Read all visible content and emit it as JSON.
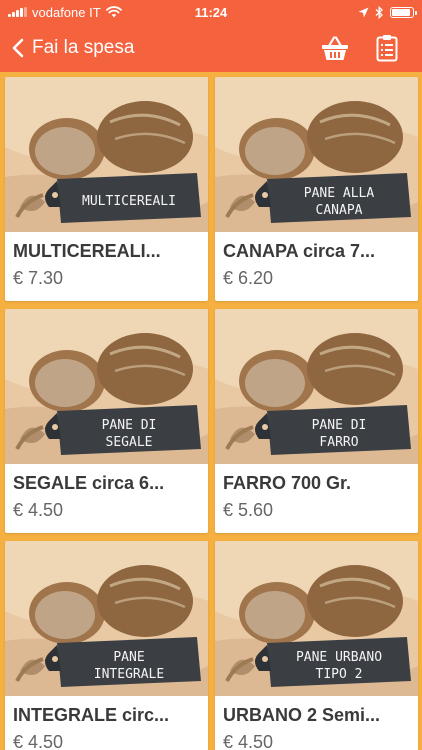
{
  "status_bar": {
    "carrier": "vodafone IT",
    "time": "11:24"
  },
  "nav": {
    "back_label": "Fai la spesa",
    "icons": [
      "chevron-left-icon",
      "basket-icon",
      "clipboard-list-icon"
    ]
  },
  "colors": {
    "header": "#F4623E",
    "background": "#F5B041",
    "card": "#FFFFFF",
    "chalkboard": "#3B3F44"
  },
  "products": [
    {
      "name": "MULTICEREALI...",
      "price": "€ 7.30",
      "label": [
        "MULTICEREALI"
      ]
    },
    {
      "name": "CANAPA circa 7...",
      "price": "€ 6.20",
      "label": [
        "PANE ALLA",
        "CANAPA"
      ]
    },
    {
      "name": "SEGALE circa 6...",
      "price": "€ 4.50",
      "label": [
        "PANE DI",
        "SEGALE"
      ]
    },
    {
      "name": "FARRO 700 Gr.",
      "price": "€ 5.60",
      "label": [
        "PANE DI",
        "FARRO"
      ]
    },
    {
      "name": "INTEGRALE circ...",
      "price": "€ 4.50",
      "label": [
        "PANE",
        "INTEGRALE"
      ]
    },
    {
      "name": "URBANO 2 Semi...",
      "price": "€ 4.50",
      "label": [
        "PANE URBANO",
        "TIPO 2"
      ]
    }
  ]
}
